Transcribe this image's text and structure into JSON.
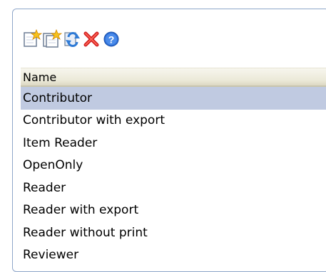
{
  "toolbar": {
    "buttons": [
      {
        "icon": "new-item-icon"
      },
      {
        "icon": "copy-item-icon"
      },
      {
        "icon": "refresh-icon"
      },
      {
        "icon": "delete-icon"
      },
      {
        "icon": "help-icon"
      }
    ]
  },
  "grid": {
    "column_header": "Name",
    "rows": [
      "Contributor",
      "Contributor with export",
      "Item Reader",
      "OpenOnly",
      "Reader",
      "Reader with export",
      "Reader without print",
      "Reviewer"
    ],
    "selected_index": 0
  },
  "colors": {
    "selection": "#c0cae1",
    "panel_border": "#8ea6c9",
    "header_bg": "#ebe9d8"
  }
}
